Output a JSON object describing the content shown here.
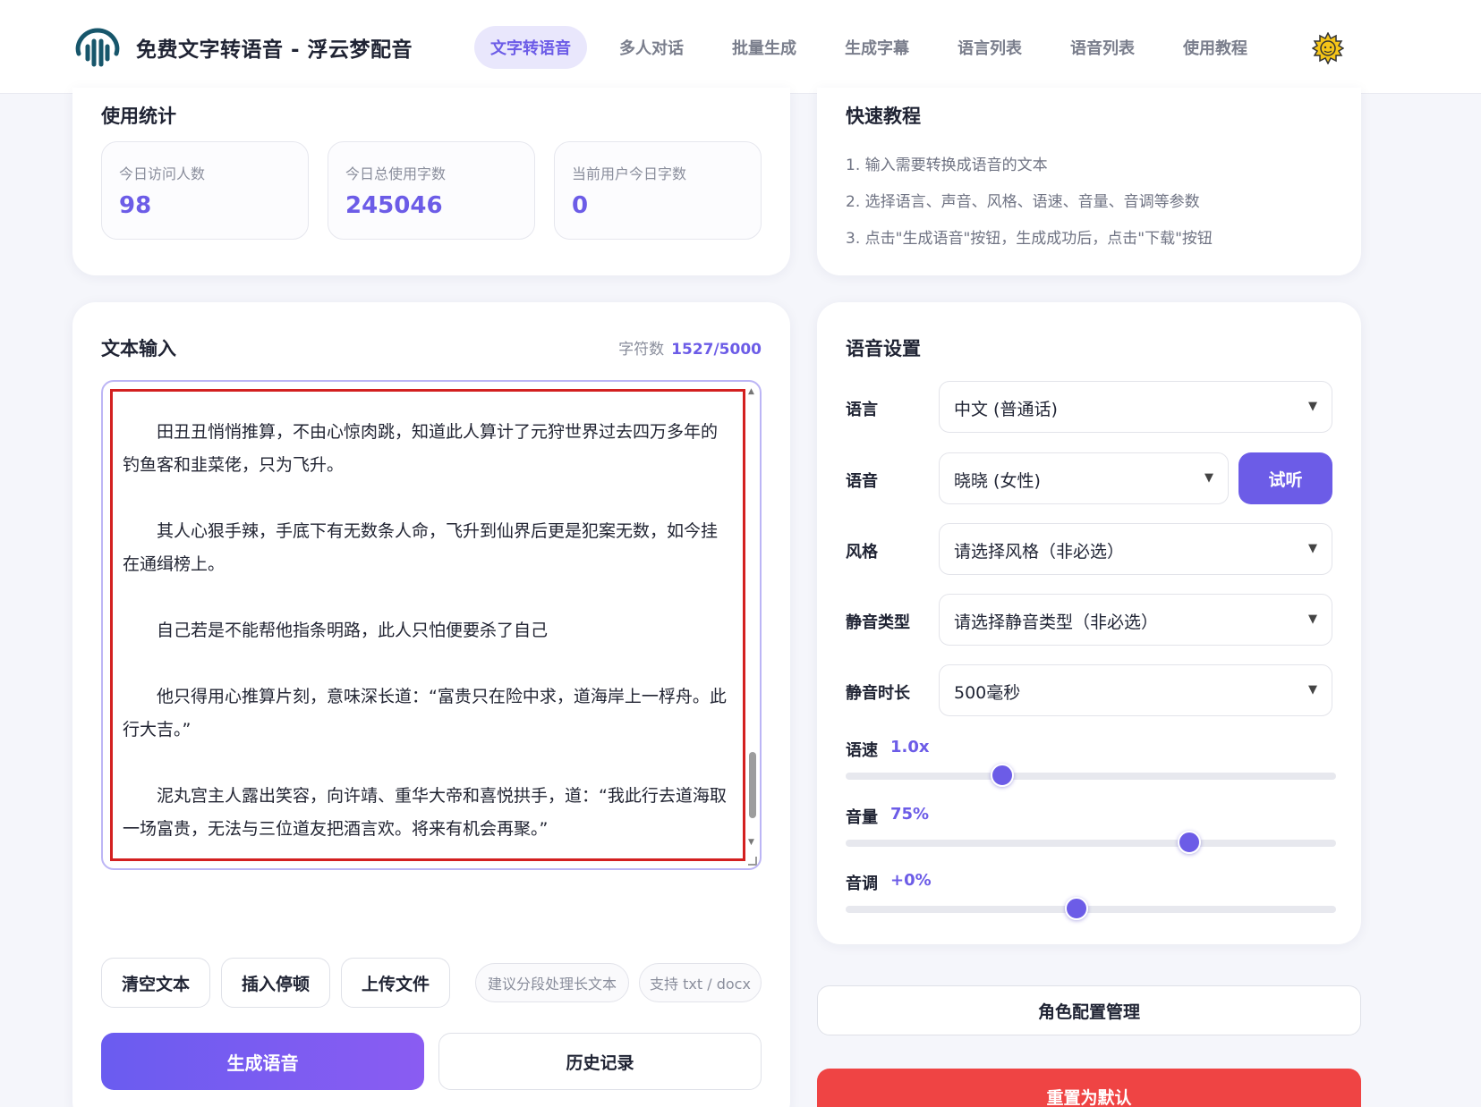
{
  "header": {
    "brand": "免费文字转语音 - 浮云梦配音",
    "nav": [
      {
        "label": "文字转语音",
        "active": true
      },
      {
        "label": "多人对话"
      },
      {
        "label": "批量生成"
      },
      {
        "label": "生成字幕"
      },
      {
        "label": "语言列表"
      },
      {
        "label": "语音列表"
      },
      {
        "label": "使用教程"
      }
    ],
    "theme_icon": "sun-icon"
  },
  "stats": {
    "title": "使用统计",
    "items": [
      {
        "label": "今日访问人数",
        "value": "98"
      },
      {
        "label": "今日总使用字数",
        "value": "245046"
      },
      {
        "label": "当前用户今日字数",
        "value": "0"
      }
    ]
  },
  "tutorial": {
    "title": "快速教程",
    "steps": [
      "1. 输入需要转换成语音的文本",
      "2. 选择语言、声音、风格、语速、音量、音调等参数",
      "3. 点击\"生成语音\"按钮，生成成功后，点击\"下载\"按钮"
    ]
  },
  "text_input": {
    "title": "文本输入",
    "char_count_label": "字符数",
    "char_count_value": "1527/5000",
    "paragraphs": [
      "田丑丑悄悄推算，不由心惊肉跳，知道此人算计了元狩世界过去四万多年的钓鱼客和韭菜佬，只为飞升。",
      "其人心狠手辣，手底下有无数条人命，飞升到仙界后更是犯案无数，如今挂在通缉榜上。",
      "自己若是不能帮他指条明路，此人只怕便要杀了自己",
      "他只得用心推算片刻，意味深长道：“富贵只在险中求，道海岸上一桴舟。此行大吉。”",
      "泥丸宫主人露出笑容，向许靖、重华大帝和喜悦拱手，道：“我此行去道海取一场富贵，无法与三位道友把酒言欢。将来有机会再聚。”"
    ],
    "buttons": {
      "clear": "清空文本",
      "insert_pause": "插入停顿",
      "upload": "上传文件"
    },
    "chips": [
      "建议分段处理长文本",
      "支持 txt / docx"
    ],
    "generate": "生成语音",
    "history": "历史记录"
  },
  "voice_settings": {
    "title": "语音设置",
    "language_label": "语言",
    "language_value": "中文 (普通话)",
    "voice_label": "语音",
    "voice_value": "晓晓 (女性)",
    "listen_button": "试听",
    "style_label": "风格",
    "style_value": "请选择风格（非必选）",
    "silence_type_label": "静音类型",
    "silence_type_value": "请选择静音类型（非必选）",
    "silence_duration_label": "静音时长",
    "silence_duration_value": "500毫秒",
    "sliders": [
      {
        "label": "语速",
        "display": "1.0x",
        "fraction": 0.32
      },
      {
        "label": "音量",
        "display": "75%",
        "fraction": 0.7
      },
      {
        "label": "音调",
        "display": "+0%",
        "fraction": 0.47
      }
    ]
  },
  "actions": {
    "role_config": "角色配置管理",
    "reset": "重置为默认"
  },
  "colors": {
    "accent": "#6c5ce7",
    "danger": "#ef4444",
    "highlight_border": "#d32020"
  }
}
